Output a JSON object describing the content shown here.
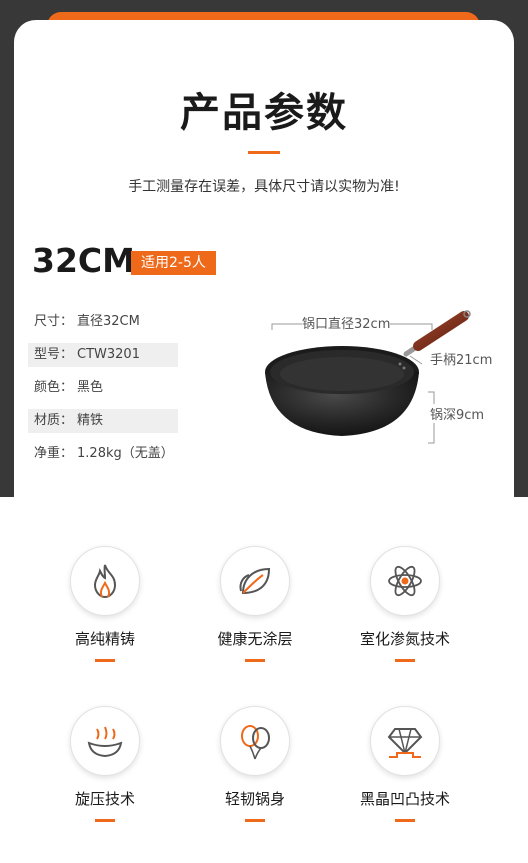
{
  "header": {
    "title": "产品参数",
    "subtitle": "手工测量存在误差，具体尺寸请以实物为准!"
  },
  "size": {
    "value": "32CM",
    "tag": "适用2-5人"
  },
  "specs": [
    {
      "label": "尺寸：",
      "value": "直径32CM"
    },
    {
      "label": "型号：",
      "value": "CTW3201"
    },
    {
      "label": "颜色：",
      "value": "黑色"
    },
    {
      "label": "材质：",
      "value": "精铁"
    },
    {
      "label": "净重：",
      "value": "1.28kg（无盖）"
    }
  ],
  "dimensions": {
    "diameter": "锅口直径32cm",
    "handle": "手柄21cm",
    "depth": "锅深9cm"
  },
  "features": [
    {
      "label": "高纯精铸",
      "icon": "flame-icon"
    },
    {
      "label": "健康无涂层",
      "icon": "leaf-icon"
    },
    {
      "label": "室化渗氮技术",
      "icon": "atom-icon"
    },
    {
      "label": "旋压技术",
      "icon": "spin-bowl-icon"
    },
    {
      "label": "轻韧锅身",
      "icon": "balloons-icon"
    },
    {
      "label": "黑晶凹凸技术",
      "icon": "diamond-icon"
    }
  ],
  "colors": {
    "accent": "#ee6a1a",
    "dark_band": "#383838"
  }
}
